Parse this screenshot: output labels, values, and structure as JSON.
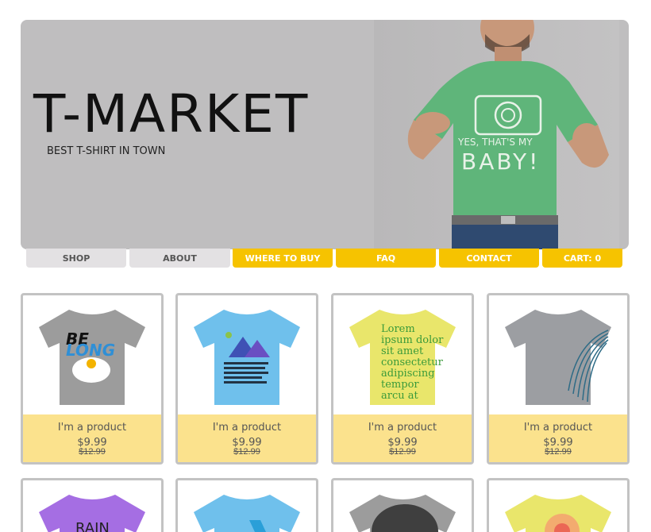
{
  "hero": {
    "title": "T-MARKET",
    "tagline": "BEST T-SHIRT IN TOWN",
    "photo_shirt_text": "YES, THAT'S MY BABY!"
  },
  "nav": {
    "items": [
      {
        "label": "SHOP",
        "style": "grey"
      },
      {
        "label": "ABOUT",
        "style": "grey"
      },
      {
        "label": "WHERE TO BUY",
        "style": "yellow"
      },
      {
        "label": "FAQ",
        "style": "yellow"
      },
      {
        "label": "CONTACT",
        "style": "yellow"
      },
      {
        "label": "CART: 0",
        "style": "yellow"
      }
    ]
  },
  "products": [
    {
      "name": "I'm a product",
      "price": "$9.99",
      "old_price": "$12.99",
      "shirt_color": "#9c9c9c",
      "graphic": "BE LONG"
    },
    {
      "name": "I'm a product",
      "price": "$9.99",
      "old_price": "$12.99",
      "shirt_color": "#6fc0ec",
      "graphic": "mountains"
    },
    {
      "name": "I'm a product",
      "price": "$9.99",
      "old_price": "$12.99",
      "shirt_color": "#e9e66b",
      "graphic": "Lorem ipsum dolor sit amet"
    },
    {
      "name": "I'm a product",
      "price": "$9.99",
      "old_price": "$12.99",
      "shirt_color": "#9c9ea2",
      "graphic": "swirl"
    }
  ],
  "products_row2": [
    {
      "shirt_color": "#a56ee3",
      "graphic_text": "RAIN"
    },
    {
      "shirt_color": "#6fc0ec",
      "graphic_text": ""
    },
    {
      "shirt_color": "#5a5a5a",
      "graphic_text": ""
    },
    {
      "shirt_color": "#e9e66b",
      "graphic_text": ""
    }
  ],
  "colors": {
    "hero_bg": "#bfbebf",
    "nav_grey": "#e3e1e3",
    "nav_yellow": "#f6c300",
    "card_info_bg": "#fbe28d",
    "card_border": "#c3c3c3"
  }
}
